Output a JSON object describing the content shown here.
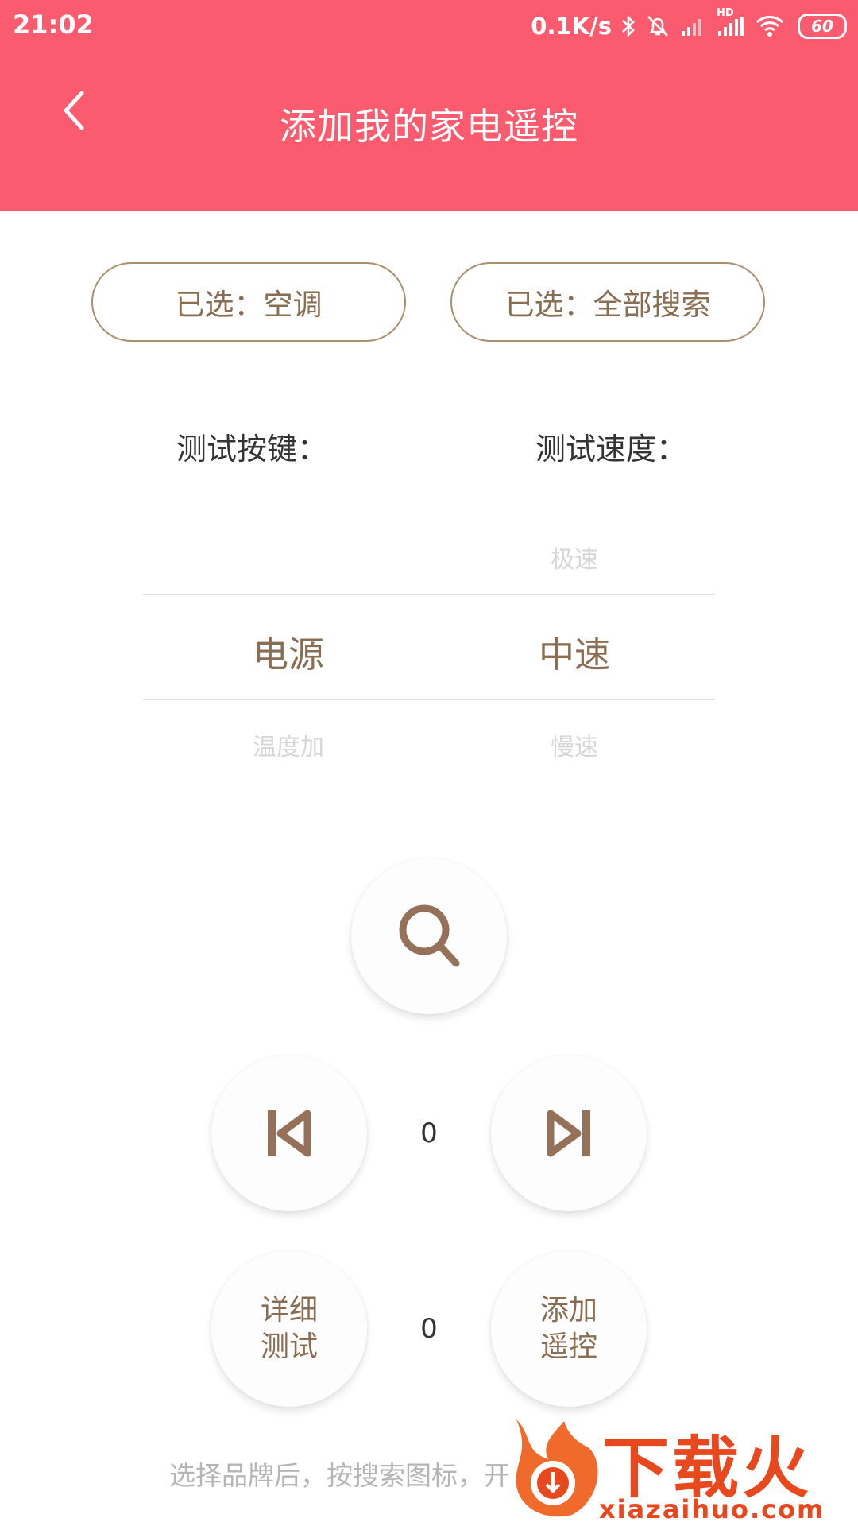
{
  "status_bar": {
    "time": "21:02",
    "network_speed": "0.1K/s",
    "hd_label": "HD",
    "battery": "60"
  },
  "header": {
    "title": "添加我的家电遥控",
    "back_icon": "chevron-left-icon"
  },
  "selection": {
    "device_chip": "已选：空调",
    "search_chip": "已选：全部搜索"
  },
  "labels": {
    "test_keys": "测试按键：",
    "test_speed": "测试速度："
  },
  "key_picker": {
    "selected": "电源",
    "below": "温度加"
  },
  "speed_picker": {
    "above": "极速",
    "selected": "中速",
    "below": "慢速"
  },
  "controls": {
    "search_icon": "search-icon",
    "prev_icon": "skip-previous-icon",
    "next_icon": "skip-next-icon",
    "counter_top": "0",
    "counter_bottom": "0",
    "detail_test_line1": "详细",
    "detail_test_line2": "测试",
    "add_remote_line1": "添加",
    "add_remote_line2": "遥控"
  },
  "hint": "选择品牌后，按搜索图标，开",
  "watermark": {
    "name": "下载火",
    "url": "xiazaihuo.com"
  },
  "colors": {
    "accent": "#fb5b6e",
    "brown": "#8a6e51",
    "watermark": "#e8481e"
  }
}
